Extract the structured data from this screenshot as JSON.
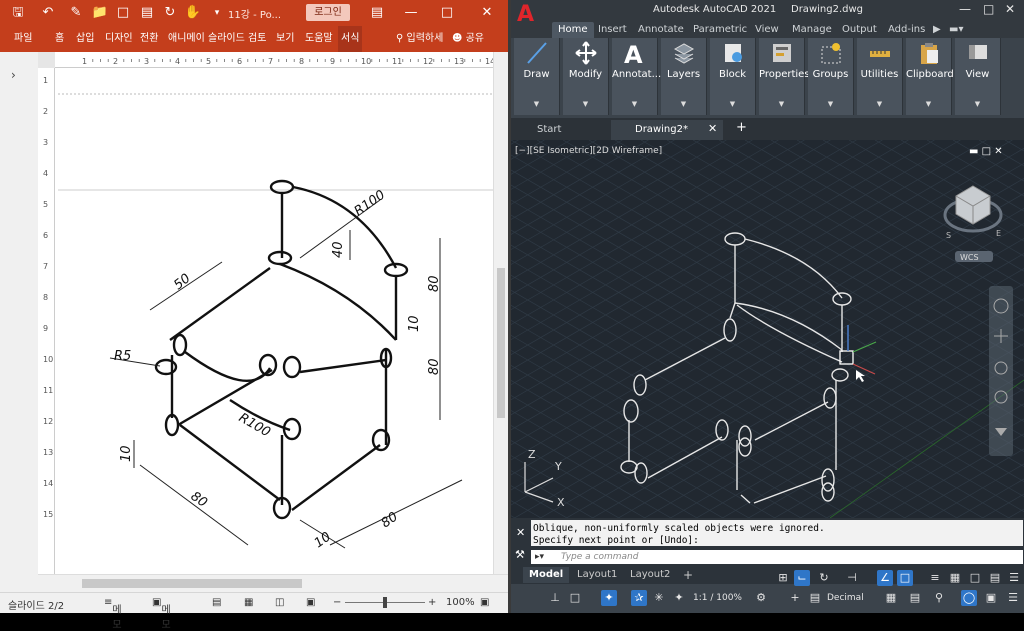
{
  "ppt": {
    "filename": "11강 - Po...",
    "login": "로그인",
    "tabs": [
      "파일",
      "홈",
      "삽입",
      "디자인",
      "전환",
      "애니메이",
      "슬라이드",
      "검토",
      "보기",
      "도움말",
      "서식"
    ],
    "selected_tab": "서식",
    "tell_me": "입력하세",
    "share": "공유",
    "ruler_numbers": [
      "1",
      "2",
      "3",
      "4",
      "5",
      "6",
      "7",
      "8",
      "9",
      "10",
      "11",
      "12",
      "13",
      "14"
    ],
    "vruler_numbers": [
      "1",
      "2",
      "3",
      "4",
      "5",
      "6",
      "7",
      "8",
      "9",
      "10",
      "11",
      "12",
      "13",
      "14",
      "15"
    ],
    "status": {
      "slide": "슬라이드 2/2",
      "notes": "메모",
      "comments": "메모",
      "zoom": "100%"
    },
    "drawing_dims": {
      "r100_top": "R100",
      "d50": "50",
      "d40": "40",
      "d80_right": "80",
      "r5": "R5",
      "d10_mid": "10",
      "d80_mid": "80",
      "r100_mid": "R100",
      "d10_left": "10",
      "d80_bottom_left": "80",
      "d10_bottom": "10",
      "d80_bottom_right": "80"
    }
  },
  "acad": {
    "app_title": "Autodesk AutoCAD 2021",
    "doc_title": "Drawing2.dwg",
    "ribbon_tabs": [
      "Home",
      "Insert",
      "Annotate",
      "Parametric",
      "View",
      "Manage",
      "Output",
      "Add-ins"
    ],
    "selected_ribbon_tab": "Home",
    "panels": [
      "Draw",
      "Modify",
      "Annotat...",
      "Layers",
      "Block",
      "Properties",
      "Groups",
      "Utilities",
      "Clipboard",
      "View"
    ],
    "doc_tabs": [
      "Start",
      "Drawing2*"
    ],
    "viewport_label": "[−][SE Isometric][2D Wireframe]",
    "viewcube": {
      "wcs": "WCS",
      "s": "S",
      "e": "E"
    },
    "ucs": {
      "x": "X",
      "y": "Y",
      "z": "Z"
    },
    "command_history": [
      "Oblique, non-uniformly scaled objects were ignored.",
      "Specify next point or [Undo]:"
    ],
    "command_placeholder": "Type a command",
    "layout_tabs": [
      "Model",
      "Layout1",
      "Layout2"
    ],
    "status": {
      "scale": "1:1 / 100%",
      "units": "Decimal"
    }
  }
}
